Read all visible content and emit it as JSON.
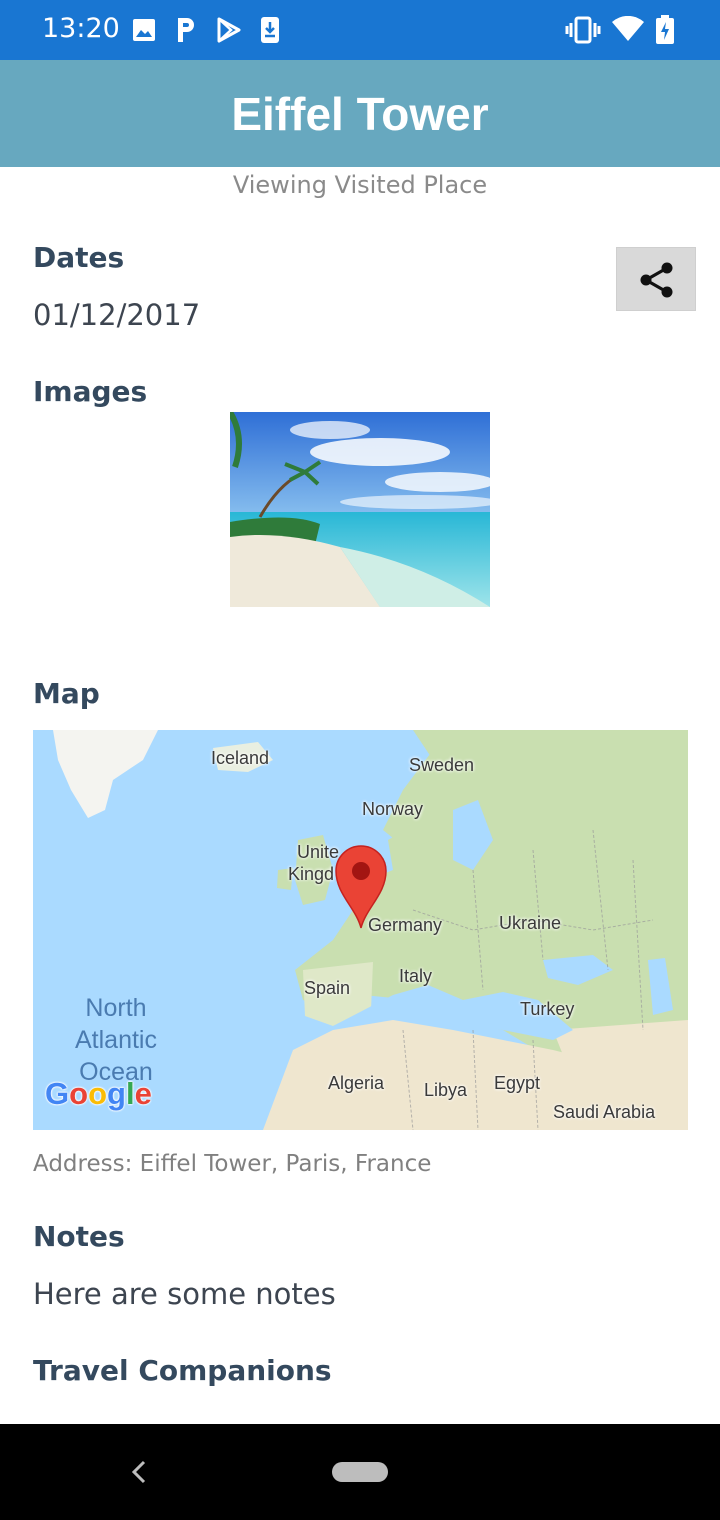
{
  "status_bar": {
    "time": "13:20",
    "left_icons": [
      "image-icon",
      "p-letter-icon",
      "play-store-icon",
      "download-icon"
    ],
    "right_icons": [
      "vibrate-icon",
      "wifi-icon",
      "battery-charging-icon"
    ],
    "background": "#1976D2"
  },
  "app_bar": {
    "title": "Eiffel Tower",
    "background": "#67A8BF"
  },
  "subtitle": "Viewing Visited Place",
  "dates": {
    "label": "Dates",
    "value": "01/12/2017"
  },
  "share": {
    "icon": "share-icon"
  },
  "images": {
    "label": "Images"
  },
  "map": {
    "label": "Map",
    "places": {
      "iceland": "Iceland",
      "sweden": "Sweden",
      "norway": "Norway",
      "uk_line1": "Unite",
      "uk_line2": "Kingd",
      "germany": "Germany",
      "ukraine": "Ukraine",
      "italy": "Italy",
      "spain": "Spain",
      "turkey": "Turkey",
      "algeria": "Algeria",
      "libya": "Libya",
      "egypt": "Egypt",
      "saudi_arabia": "Saudi Arabia",
      "ocean_line1": "North",
      "ocean_line2": "Atlantic",
      "ocean_line3": "Ocean"
    },
    "marker_icon": "map-pin-icon",
    "logo": "Google"
  },
  "address": "Address: Eiffel Tower, Paris, France",
  "notes": {
    "label": "Notes",
    "value": "Here are some notes"
  },
  "companions": {
    "label": "Travel Companions"
  },
  "nav_bar": {
    "back_icon": "back-chevron-icon",
    "home_icon": "home-pill-icon"
  }
}
